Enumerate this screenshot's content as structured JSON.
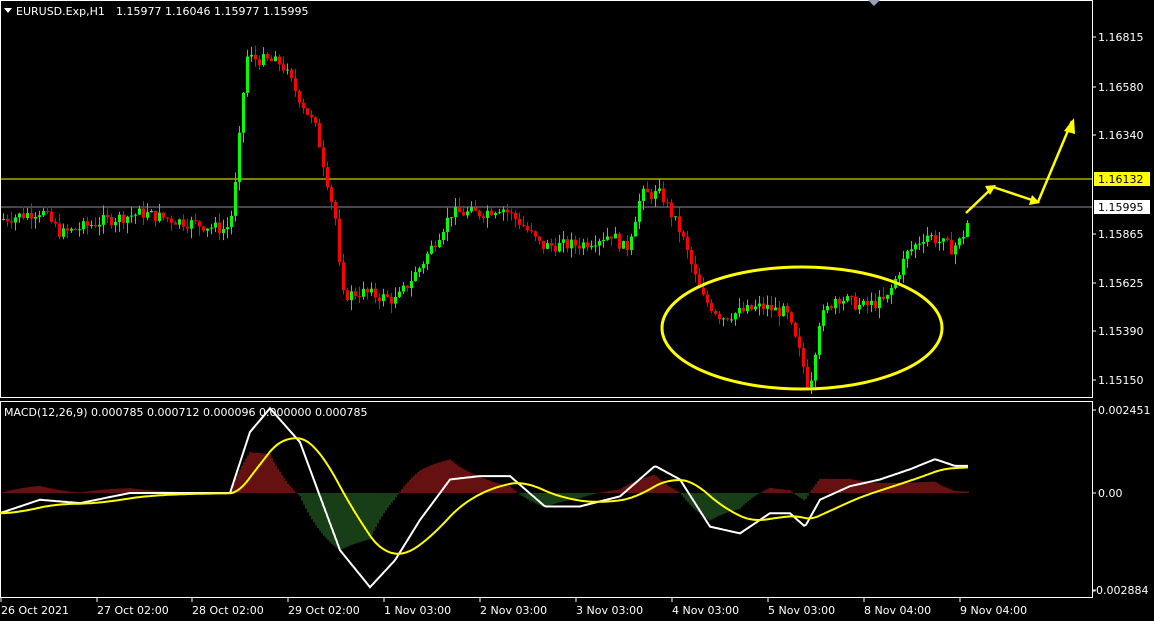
{
  "window": {
    "symbol_label": "EURUSD.Exp,H1",
    "ohlc_label": "1.15977 1.16046 1.15977 1.15995",
    "macd_label": "MACD(12,26,9) 0.000785 0.000712 0.000096 0.000000 0.000785"
  },
  "colors": {
    "background": "#000000",
    "grid_border": "#ffffff",
    "bull_candle": "#00ff00",
    "bear_candle": "#ff0000",
    "annotation": "#ffff00",
    "macd_main": "#ffffff",
    "macd_signal": "#ffff00",
    "hist_positive": "#cc2222",
    "hist_negative": "#2e7d2e",
    "bid_line": "#8a8aa0",
    "level_line": "#ffff00"
  },
  "price_axis": {
    "ticks": [
      "1.16815",
      "1.16580",
      "1.16340",
      "1.16132",
      "1.15995",
      "1.15865",
      "1.15625",
      "1.15390",
      "1.15150"
    ],
    "tick_values": [
      1.16815,
      1.1658,
      1.1634,
      1.16132,
      1.15995,
      1.15865,
      1.15625,
      1.1539,
      1.1515
    ],
    "level_tag": "1.16132",
    "bid_tag": "1.15995"
  },
  "macd_axis": {
    "ticks": [
      "0.002451",
      "0.00",
      "-0.002884"
    ]
  },
  "time_axis": {
    "labels": [
      "26 Oct 2021",
      "27 Oct 02:00",
      "28 Oct 02:00",
      "29 Oct 02:00",
      "1 Nov 03:00",
      "2 Nov 03:00",
      "3 Nov 03:00",
      "4 Nov 03:00",
      "5 Nov 03:00",
      "8 Nov 04:00",
      "9 Nov 04:00"
    ]
  },
  "chart_data": {
    "type": "line",
    "x": [
      "26 Oct 2021",
      "27 Oct 02:00",
      "28 Oct 02:00",
      "29 Oct 02:00",
      "1 Nov 03:00",
      "2 Nov 03:00",
      "3 Nov 03:00",
      "4 Nov 03:00",
      "5 Nov 03:00",
      "8 Nov 04:00",
      "9 Nov 04:00"
    ],
    "series": [
      {
        "name": "EURUSD.Exp,H1",
        "values": [
          1.1597,
          1.1595,
          1.1595,
          1.1656,
          1.1558,
          1.1603,
          1.159,
          1.159,
          1.156,
          1.1575,
          1.1599
        ]
      }
    ],
    "ylim": [
      1.1512,
      1.1701
    ],
    "macd": {
      "label": "MACD(12,26,9)",
      "values": {
        "main": 0.000785,
        "signal": 0.000712,
        "histogram": 9.6e-05
      },
      "ylim": [
        -0.002884,
        0.002451
      ]
    }
  }
}
